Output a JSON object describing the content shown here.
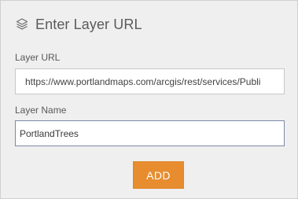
{
  "panel": {
    "title": "Enter Layer URL",
    "header_icon": "layers-icon"
  },
  "form": {
    "url_label": "Layer URL",
    "url_value": "https://www.portlandmaps.com/arcgis/rest/services/Publi",
    "name_label": "Layer Name",
    "name_value": "PortlandTrees"
  },
  "actions": {
    "add_label": "ADD"
  },
  "colors": {
    "panel_bg": "#efefef",
    "accent_button": "#e78d2f",
    "focused_border": "#7a8aa6"
  }
}
